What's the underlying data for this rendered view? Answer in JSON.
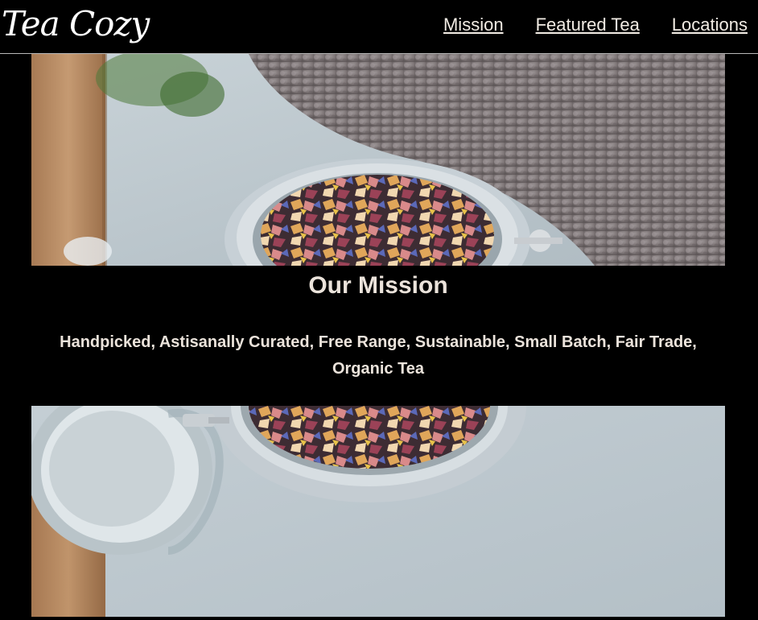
{
  "header": {
    "logo": "Tea Cozy",
    "nav": [
      {
        "label": "Mission"
      },
      {
        "label": "Featured Tea"
      },
      {
        "label": "Locations"
      }
    ]
  },
  "mission": {
    "title": "Our Mission",
    "text": "Handpicked, Astisanally Curated, Free Range, Sustainable, Small Batch, Fair Trade, Organic Tea"
  },
  "images": {
    "top": "jar-of-loose-leaf-tea-photo",
    "bottom": "jar-of-loose-leaf-tea-photo"
  },
  "colors": {
    "background": "#000000",
    "text": "#ebe3db"
  }
}
